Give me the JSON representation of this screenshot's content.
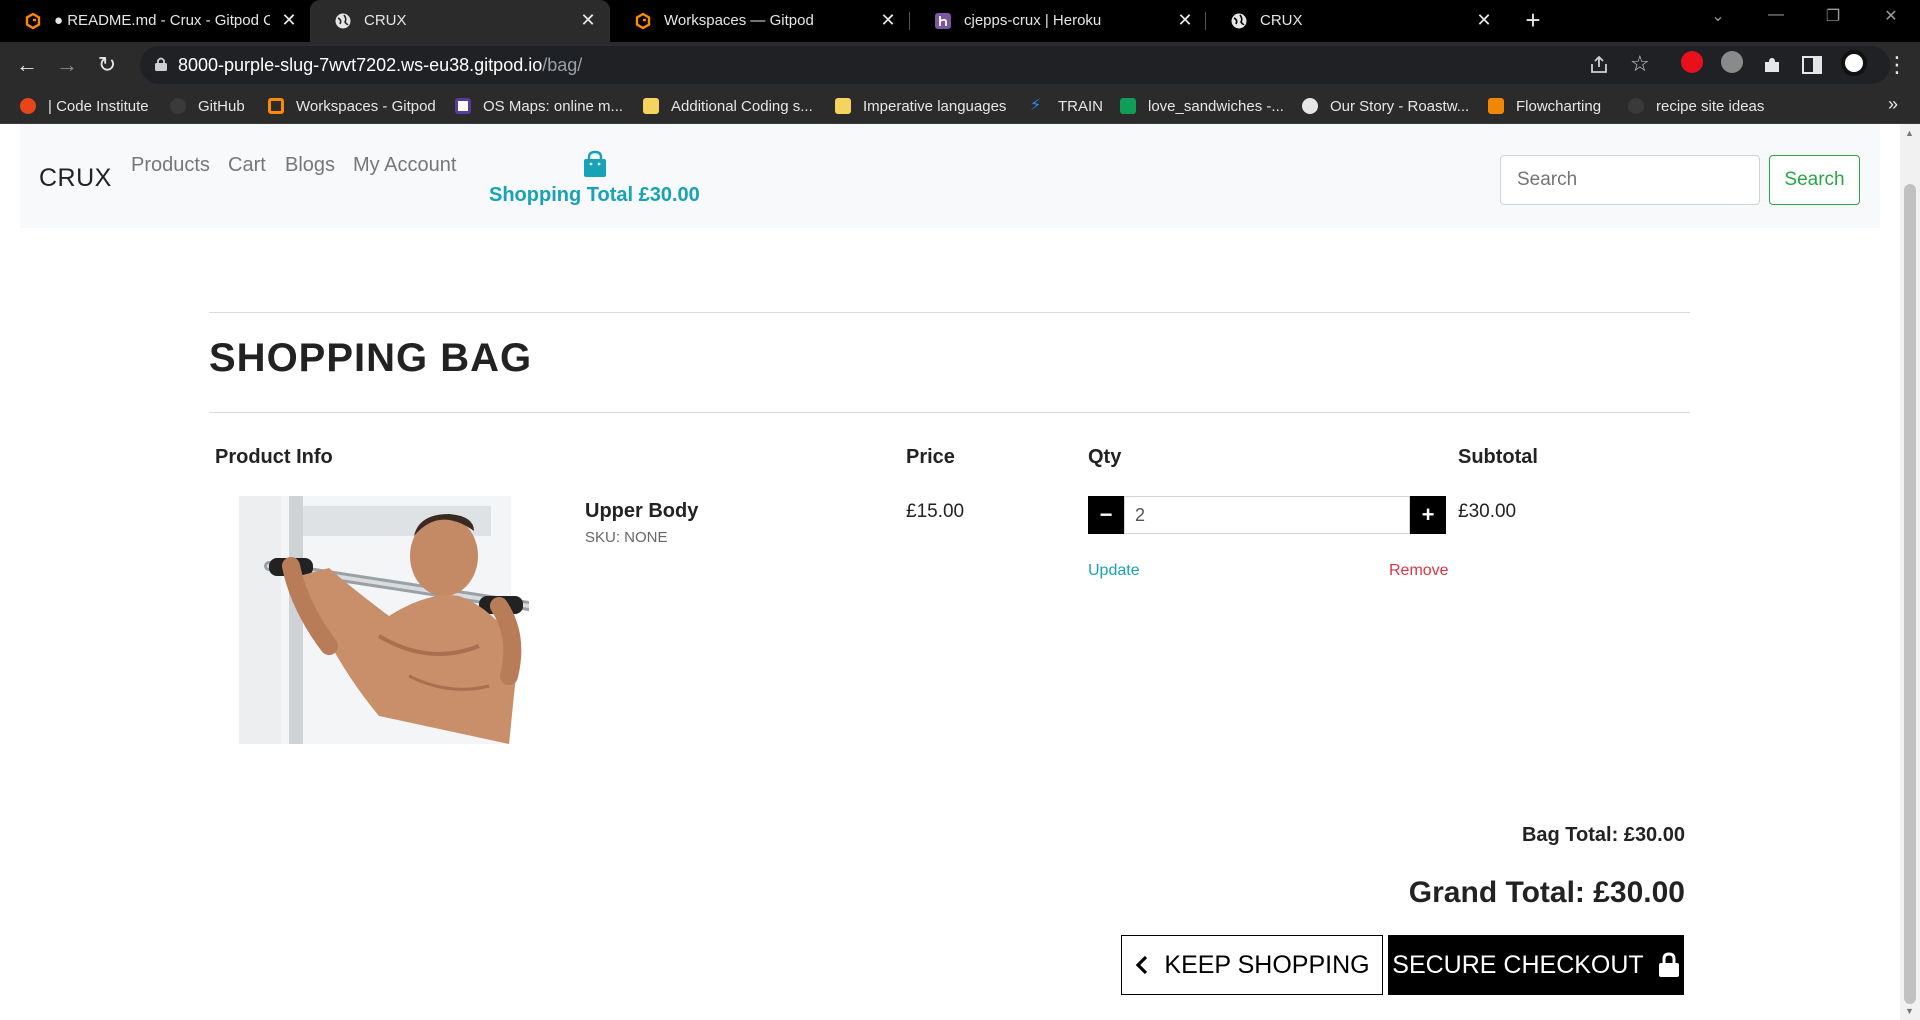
{
  "browser": {
    "tabs": [
      {
        "title": "● README.md - Crux - Gitpod Co",
        "icon": "gitpod-icon"
      },
      {
        "title": "CRUX",
        "icon": "globe-icon",
        "active": true
      },
      {
        "title": "Workspaces — Gitpod",
        "icon": "gitpod-icon"
      },
      {
        "title": "cjepps-crux | Heroku",
        "icon": "heroku-icon"
      },
      {
        "title": "CRUX",
        "icon": "globe-icon"
      }
    ],
    "url_host": "8000-purple-slug-7wvt7202.ws-eu38.gitpod.io",
    "url_path": "/bag/",
    "bookmarks": [
      {
        "label": "| Code Institute",
        "icon": "code-institute-icon"
      },
      {
        "label": "GitHub",
        "icon": "github-icon"
      },
      {
        "label": "Workspaces - Gitpod",
        "icon": "gitpod-icon"
      },
      {
        "label": "OS Maps: online m...",
        "icon": "os-maps-icon"
      },
      {
        "label": "Additional Coding s...",
        "icon": "folder-icon"
      },
      {
        "label": "Imperative languages",
        "icon": "folder-icon"
      },
      {
        "label": "TRAIN",
        "icon": "train-icon"
      },
      {
        "label": "love_sandwiches -...",
        "icon": "sheets-icon"
      },
      {
        "label": "Our Story - Roastw...",
        "icon": "globe-icon"
      },
      {
        "label": "Flowcharting",
        "icon": "flowchart-icon"
      },
      {
        "label": "recipe site ideas",
        "icon": "github-icon"
      }
    ]
  },
  "site": {
    "brand": "CRUX",
    "nav": [
      "Products",
      "Cart",
      "Blogs",
      "My Account"
    ],
    "shopping_total": "Shopping Total £30.00",
    "search_placeholder": "Search",
    "search_button": "Search"
  },
  "bag": {
    "title": "SHOPPING BAG",
    "headers": {
      "product": "Product Info",
      "price": "Price",
      "qty": "Qty",
      "subtotal": "Subtotal"
    },
    "items": [
      {
        "name": "Upper Body",
        "sku": "SKU: NONE",
        "price": "£15.00",
        "qty": "2",
        "update": "Update",
        "remove": "Remove",
        "subtotal": "£30.00"
      }
    ],
    "bag_total": "Bag Total: £30.00",
    "grand_total": "Grand Total: £30.00",
    "keep_shopping": "KEEP SHOPPING",
    "secure_checkout": "SECURE CHECKOUT"
  },
  "colors": {
    "accent": "#17a2b8",
    "success": "#28a745",
    "danger": "#dc3545",
    "chrome": "#2b2b2b"
  }
}
